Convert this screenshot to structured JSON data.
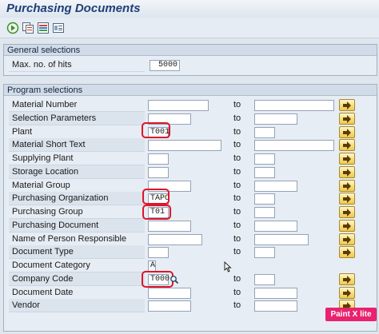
{
  "window": {
    "title": "Purchasing Documents"
  },
  "toolbar": {
    "icons": [
      "execute-icon",
      "copy-variant-icon",
      "selection-options-icon",
      "dynamic-selections-icon"
    ]
  },
  "general": {
    "header": "General selections",
    "max_hits_label": "Max. no. of hits",
    "max_hits_value": "5000"
  },
  "program": {
    "header": "Program selections",
    "to_label": "to",
    "rows": [
      {
        "label": "Material Number",
        "from": "",
        "to": ""
      },
      {
        "label": "Selection Parameters",
        "from": "",
        "to": ""
      },
      {
        "label": "Plant",
        "from": "T001",
        "to": ""
      },
      {
        "label": "Material Short Text",
        "from": "",
        "to": ""
      },
      {
        "label": "Supplying Plant",
        "from": "",
        "to": ""
      },
      {
        "label": "Storage Location",
        "from": "",
        "to": ""
      },
      {
        "label": "Material Group",
        "from": "",
        "to": ""
      },
      {
        "label": "Purchasing Organization",
        "from": "TAPO",
        "to": ""
      },
      {
        "label": "Purchasing Group",
        "from": "T01",
        "to": ""
      },
      {
        "label": "Purchasing Document",
        "from": "",
        "to": ""
      },
      {
        "label": "Name of Person Responsible",
        "from": "",
        "to": ""
      },
      {
        "label": "Document Type",
        "from": "",
        "to": ""
      },
      {
        "label": "Document Category",
        "from": "A",
        "to": ""
      },
      {
        "label": "Company Code",
        "from": "T000",
        "to": ""
      },
      {
        "label": "Document Date",
        "from": "",
        "to": ""
      },
      {
        "label": "Vendor",
        "from": "",
        "to": ""
      }
    ]
  },
  "badge": {
    "text": "Paint X lite"
  },
  "colors": {
    "title": "#1f3f78",
    "highlight": "#e0142a",
    "badge": "#e8226e"
  }
}
